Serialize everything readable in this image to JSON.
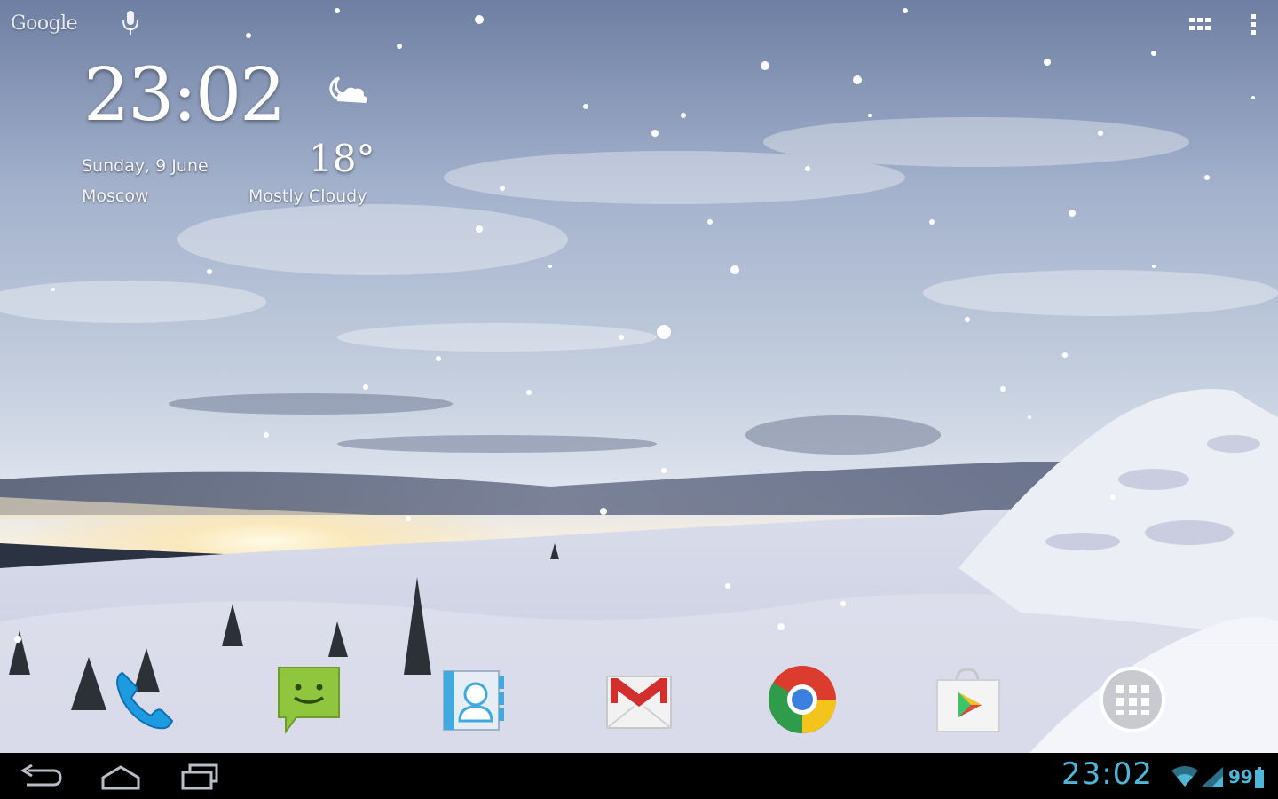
{
  "top_bar": {
    "search_logo": "Google",
    "mic_icon": "microphone-icon",
    "apps_icon": "apps-grid-icon",
    "menu_icon": "overflow-menu-icon"
  },
  "clock_widget": {
    "time": "23:02",
    "date": "Sunday, 9 June",
    "city": "Moscow",
    "temperature": "18°",
    "condition": "Mostly Cloudy",
    "weather_icon": "cloud-moon-icon"
  },
  "dock": {
    "apps": [
      {
        "name": "phone",
        "icon": "phone-icon"
      },
      {
        "name": "messaging",
        "icon": "messaging-icon"
      },
      {
        "name": "contacts",
        "icon": "contacts-icon"
      },
      {
        "name": "gmail",
        "icon": "gmail-icon"
      },
      {
        "name": "chrome",
        "icon": "chrome-icon"
      },
      {
        "name": "play-store",
        "icon": "play-store-icon"
      },
      {
        "name": "app-drawer",
        "icon": "app-drawer-icon"
      }
    ]
  },
  "nav_bar": {
    "back_icon": "back-icon",
    "home_icon": "home-icon",
    "recents_icon": "recent-apps-icon",
    "time": "23:02",
    "battery_level": "99",
    "wifi_icon": "wifi-icon",
    "signal_icon": "signal-icon",
    "battery_icon": "battery-icon"
  },
  "colors": {
    "accent": "#4fb6d8",
    "navbar": "#000000",
    "sky_top": "#6e80a4",
    "snow": "#eef0f5"
  }
}
